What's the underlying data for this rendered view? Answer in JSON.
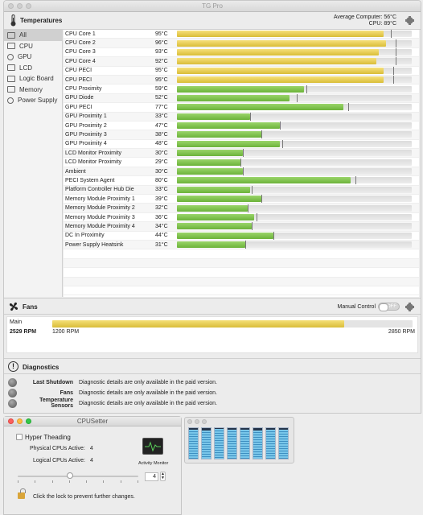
{
  "main_window": {
    "title": "TG Pro",
    "temps_section": {
      "label": "Temperatures",
      "average_label": "Average Computer:",
      "average_value": "56°C",
      "cpu_label": "CPU:",
      "cpu_value": "89°C"
    },
    "sidebar": [
      {
        "label": "All",
        "icon": "list-icon",
        "active": true
      },
      {
        "label": "CPU",
        "icon": "cpu-icon",
        "active": false
      },
      {
        "label": "GPU",
        "icon": "gpu-icon",
        "active": false
      },
      {
        "label": "LCD",
        "icon": "monitor-icon",
        "active": false
      },
      {
        "label": "Logic Board",
        "icon": "logic-board-icon",
        "active": false
      },
      {
        "label": "Memory",
        "icon": "memory-icon",
        "active": false
      },
      {
        "label": "Power Supply",
        "icon": "power-icon",
        "active": false
      }
    ],
    "sensors": [
      {
        "name": "CPU Core 1",
        "value": "95°C",
        "level": 0.88,
        "max": 0.91,
        "color": "#d9bd38"
      },
      {
        "name": "CPU Core 2",
        "value": "96°C",
        "level": 0.89,
        "max": 0.93,
        "color": "#d9bd38"
      },
      {
        "name": "CPU Core 3",
        "value": "93°C",
        "level": 0.86,
        "max": 0.93,
        "color": "#d9bd38"
      },
      {
        "name": "CPU Core 4",
        "value": "92°C",
        "level": 0.85,
        "max": 0.93,
        "color": "#d9bd38"
      },
      {
        "name": "CPU PECI",
        "value": "95°C",
        "level": 0.88,
        "max": 0.92,
        "color": "#d9bd38"
      },
      {
        "name": "CPU PECI",
        "value": "95°C",
        "level": 0.88,
        "max": 0.92,
        "color": "#d9bd38"
      },
      {
        "name": "CPU Proximity",
        "value": "59°C",
        "level": 0.54,
        "max": 0.55,
        "color": "#6cb33a"
      },
      {
        "name": "GPU Diode",
        "value": "52°C",
        "level": 0.48,
        "max": 0.51,
        "color": "#6cb33a"
      },
      {
        "name": "GPU PECI",
        "value": "77°C",
        "level": 0.71,
        "max": 0.73,
        "color": "#6cb33a"
      },
      {
        "name": "GPU Proximity 1",
        "value": "33°C",
        "level": 0.31,
        "max": 0.31,
        "color": "#6cb33a"
      },
      {
        "name": "GPU Proximity 2",
        "value": "47°C",
        "level": 0.44,
        "max": 0.44,
        "color": "#6cb33a"
      },
      {
        "name": "GPU Proximity 3",
        "value": "38°C",
        "level": 0.36,
        "max": 0.36,
        "color": "#6cb33a"
      },
      {
        "name": "GPU Proximity 4",
        "value": "48°C",
        "level": 0.44,
        "max": 0.45,
        "color": "#6cb33a"
      },
      {
        "name": "LCD Monitor Proximity",
        "value": "30°C",
        "level": 0.28,
        "max": 0.28,
        "color": "#6cb33a"
      },
      {
        "name": "LCD Monitor Proximity",
        "value": "29°C",
        "level": 0.27,
        "max": 0.27,
        "color": "#6cb33a"
      },
      {
        "name": "Ambient",
        "value": "30°C",
        "level": 0.28,
        "max": 0.28,
        "color": "#6cb33a"
      },
      {
        "name": "PECI System Agent",
        "value": "80°C",
        "level": 0.74,
        "max": 0.76,
        "color": "#6cb33a"
      },
      {
        "name": "Platform Controller Hub Die",
        "value": "33°C",
        "level": 0.31,
        "max": 0.32,
        "color": "#6cb33a"
      },
      {
        "name": "Memory Module Proximity 1",
        "value": "39°C",
        "level": 0.36,
        "max": 0.36,
        "color": "#6cb33a"
      },
      {
        "name": "Memory Module Proximity 2",
        "value": "32°C",
        "level": 0.3,
        "max": 0.3,
        "color": "#6cb33a"
      },
      {
        "name": "Memory Module Proximity 3",
        "value": "36°C",
        "level": 0.33,
        "max": 0.34,
        "color": "#6cb33a"
      },
      {
        "name": "Memory Module Proximity 4",
        "value": "34°C",
        "level": 0.32,
        "max": 0.32,
        "color": "#6cb33a"
      },
      {
        "name": "DC In Proximity",
        "value": "44°C",
        "level": 0.41,
        "max": 0.41,
        "color": "#6cb33a"
      },
      {
        "name": "Power Supply Heatsink",
        "value": "31°C",
        "level": 0.29,
        "max": 0.29,
        "color": "#6cb33a"
      }
    ],
    "fans_section": {
      "label": "Fans",
      "manual_control_label": "Manual Control",
      "toggle_text": "OFF",
      "fan": {
        "name": "Main",
        "rpm": "2529 RPM",
        "min": "1200 RPM",
        "max": "2850 RPM",
        "level": 0.81
      }
    },
    "diagnostics_section": {
      "label": "Diagnostics",
      "rows": [
        {
          "label": "Last Shutdown",
          "text": "Diagnostic details are only available in the paid version."
        },
        {
          "label": "Fans",
          "text": "Diagnostic details are only available in the paid version."
        },
        {
          "label": "Temperature Sensors",
          "text": "Diagnostic details are only available in the paid version."
        }
      ]
    }
  },
  "cpusetter_window": {
    "title": "CPUSetter",
    "hyper_threading_label": "Hyper Theading",
    "physical_label": "Physical CPUs Active:",
    "physical_value": "4",
    "logical_label": "Logical CPUs Active:",
    "logical_value": "4",
    "activity_monitor_label": "Activity Monitor",
    "slider_level": 0.43,
    "stepper_value": "4",
    "lock_text": "Click the lock to prevent further changes."
  },
  "activity_monitor_cpu": {
    "core_levels": [
      0.95,
      0.93,
      0.97,
      0.94,
      0.96,
      0.92,
      0.95,
      0.94
    ]
  }
}
